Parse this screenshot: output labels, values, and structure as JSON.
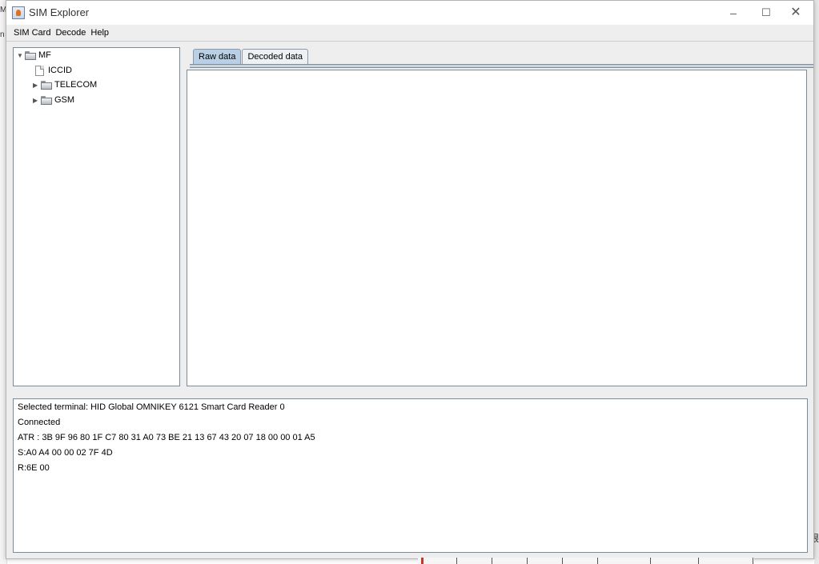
{
  "background": {
    "left_fragments": [
      "M",
      "n"
    ],
    "right_fragment": "限"
  },
  "window": {
    "title": "SIM Explorer",
    "controls": {
      "minimize": "–",
      "maximize": "☐",
      "close": "✕"
    }
  },
  "menubar": {
    "items": [
      "SIM Card",
      "Decode",
      "Help"
    ]
  },
  "tree": {
    "nodes": [
      {
        "label": "MF",
        "expanded": true,
        "type": "folder"
      },
      {
        "label": "ICCID",
        "type": "file"
      },
      {
        "label": "TELECOM",
        "expanded": false,
        "type": "folder"
      },
      {
        "label": "GSM",
        "expanded": false,
        "type": "folder"
      }
    ]
  },
  "tabs": {
    "items": [
      {
        "label": "Raw data",
        "active": true
      },
      {
        "label": "Decoded data",
        "active": false
      }
    ]
  },
  "console": {
    "lines": [
      "Selected terminal: HID Global OMNIKEY 6121 Smart Card Reader 0",
      "Connected",
      "ATR : 3B 9F 96 80 1F C7 80 31 A0 73 BE 21 13 67 43 20 07 18 00 00 01 A5",
      "S:A0 A4 00 00 02 7F 4D",
      "R:6E 00"
    ]
  },
  "colors": {
    "window_bg": "#eeeeee",
    "active_tab": "#b8cfe5",
    "panel_border": "#7a8a99"
  }
}
